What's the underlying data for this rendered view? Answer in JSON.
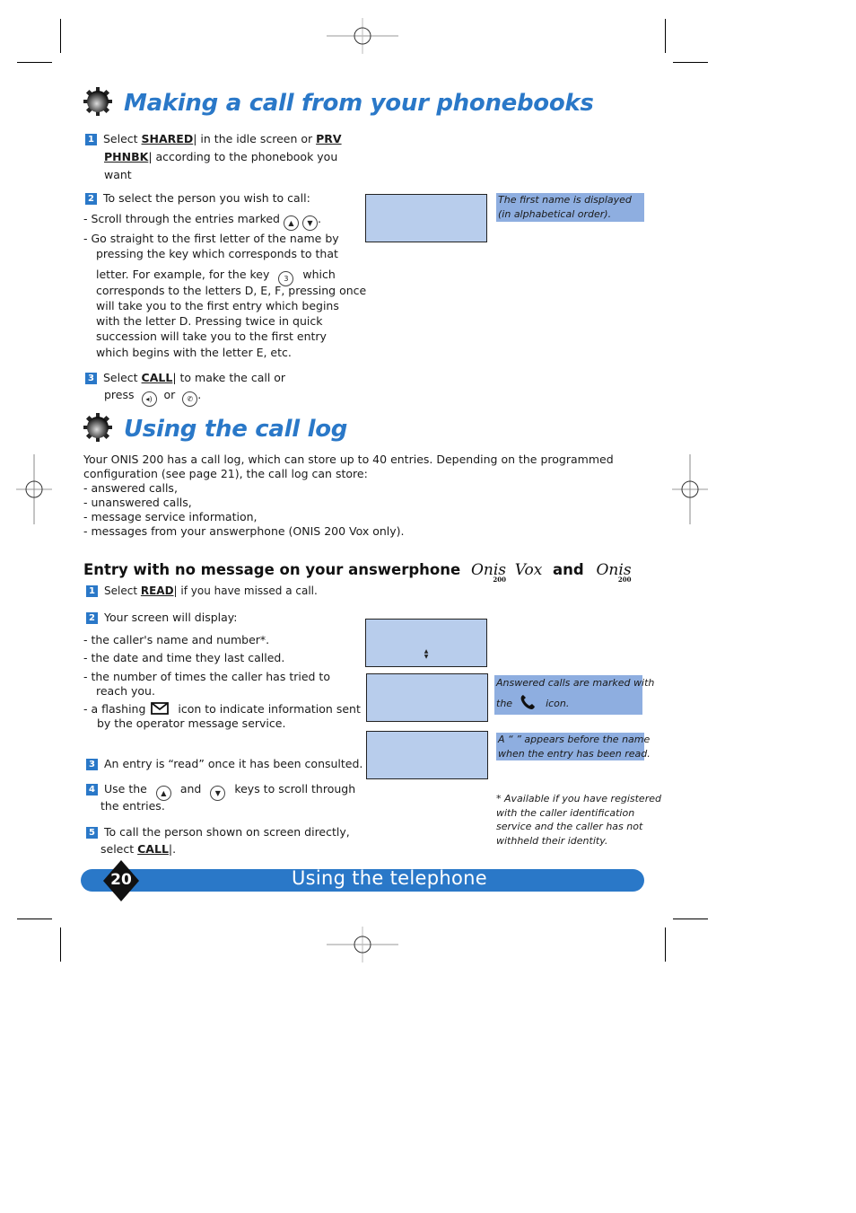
{
  "section1": {
    "title": "Making a call from your phonebooks",
    "steps": [
      {
        "num": "1",
        "pre": "Select ",
        "kw1": "SHARED",
        "mid": "| in the idle screen or ",
        "kw2": "PRV",
        "kw3": "PHNBK",
        "post": "| according to the phonebook you",
        "post2": "want"
      },
      {
        "num": "2",
        "text": "To select the person you wish to call:"
      },
      {
        "num": "3",
        "pre": "Select ",
        "kw": "CALL",
        "post": "| to make the call or",
        "line2a": "press",
        "line2b": "or"
      }
    ],
    "bullets": {
      "scroll": "- Scroll through the entries marked",
      "goto_lines": [
        "- Go straight to the first letter of the name by",
        "pressing the key which corresponds to that",
        "letter. For example, for the key",
        "which",
        "corresponds to the letters D, E, F, pressing once",
        "will take you to the first entry which begins",
        "with the letter D. Pressing twice in quick",
        "succession will take you to the first entry",
        "which begins with the letter E, etc."
      ]
    },
    "note": [
      "The first name is displayed",
      "(in alphabetical order)."
    ],
    "key_labels": {
      "up": "▲",
      "down": "▼",
      "three": "3",
      "speaker": "◂)",
      "handset": "✆"
    }
  },
  "section2": {
    "title": "Using the call log",
    "intro": [
      "Your ONIS 200 has a call log, which can store up to 40 entries. Depending on the programmed",
      "configuration (see page 21), the call log can store:",
      "- answered calls,",
      "- unanswered calls,",
      "- message service information,",
      "- messages from your answerphone (ONIS 200 Vox only)."
    ],
    "subheading": {
      "text": "Entry with no message on your answerphone",
      "brand1": "Onis",
      "brand1_sub": "200",
      "brand1_suffix": "Vox",
      "and": "and",
      "brand2": "Onis",
      "brand2_sub": "200"
    },
    "steps": [
      {
        "num": "1",
        "pre": "Select ",
        "kw": "READ",
        "post": "| if you have missed a call."
      },
      {
        "num": "2",
        "text": "Your screen will display:"
      },
      {
        "num": "3",
        "text": "An entry is “read” once it has been consulted."
      },
      {
        "num": "4",
        "pre": "Use the",
        "mid": "and",
        "post": "keys to scroll through",
        "line2": "the entries."
      },
      {
        "num": "5",
        "text": "To call the person shown on screen directly,",
        "line2pre": "select ",
        "kw": "CALL",
        "line2post": "|."
      }
    ],
    "display_items": [
      "- the caller's name and number*.",
      "- the date and time they last called.",
      "- the number of times the caller has tried to",
      "reach you.",
      "- a flashing",
      "icon to indicate information sent",
      "by the operator message service."
    ],
    "notes": {
      "answered": [
        "Answered calls are marked with",
        "the",
        "icon."
      ],
      "read": [
        "A “  ” appears before the name",
        "when the entry has been read."
      ]
    },
    "footnote": [
      "* Available if you have registered",
      "with the caller identification",
      "service and the caller has not",
      "withheld their identity."
    ],
    "scroll_indicator": "▲▼"
  },
  "footer": {
    "page_number": "20",
    "section_title": "Using the telephone"
  },
  "colors": {
    "accent_blue": "#2a78c8",
    "lcd_fill": "#b8cdec",
    "note_fill": "#8eaee0"
  }
}
